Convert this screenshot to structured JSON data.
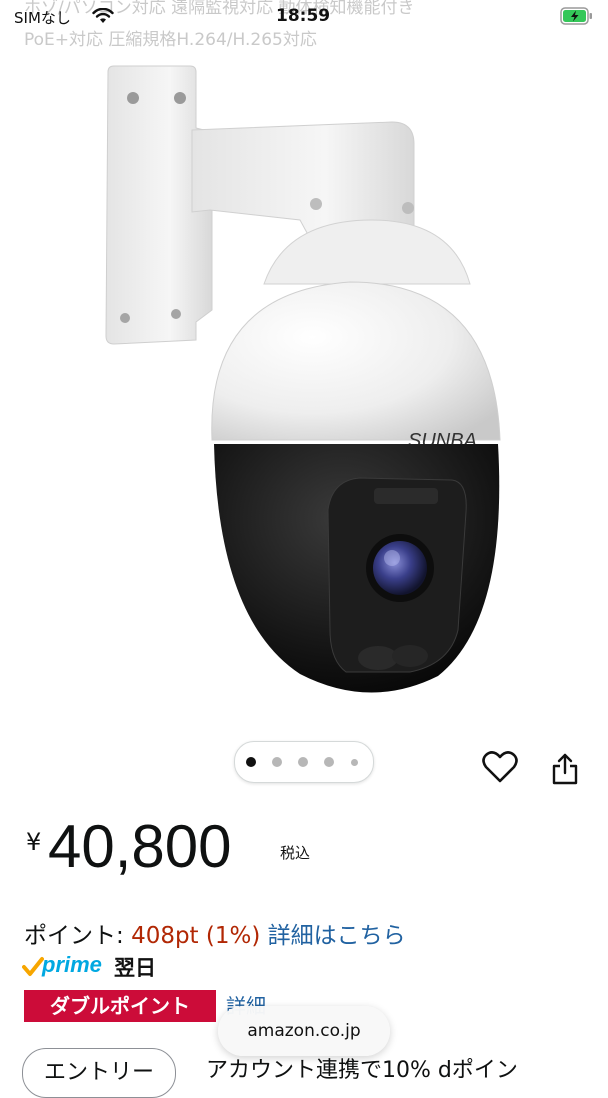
{
  "status_bar": {
    "carrier": "SIMなし",
    "time": "18:59"
  },
  "product": {
    "title_overlay_line1": "ホゾ/パソコン対応 遠隔監視対応 動体検知機能付き",
    "title_overlay_line2": "PoE+対応 圧縮規格H.264/H.265対応",
    "brand": "SUNBA",
    "image_count": 5,
    "active_image_index": 0
  },
  "price": {
    "currency": "¥",
    "amount": "40,800",
    "tax_label": "税込"
  },
  "points": {
    "label": "ポイント:",
    "value": "408pt",
    "percent": "(1%)",
    "link": "詳細はこちら"
  },
  "prime": {
    "word": "prime",
    "delivery": "翌日"
  },
  "promo": {
    "badge": "ダブルポイント",
    "detail_link": "詳細"
  },
  "browser": {
    "url": "amazon.co.jp"
  },
  "entry": {
    "button": "エントリー",
    "text": "アカウント連携で10% dポイン"
  },
  "icons": {
    "wishlist": "heart-icon",
    "share": "share-icon",
    "wifi": "wifi-icon",
    "battery": "battery-charging-icon"
  },
  "colors": {
    "price_red": "#b12704",
    "link_blue": "#2162a1",
    "badge_red": "#cc0c39",
    "prime_blue": "#00a8e1"
  }
}
